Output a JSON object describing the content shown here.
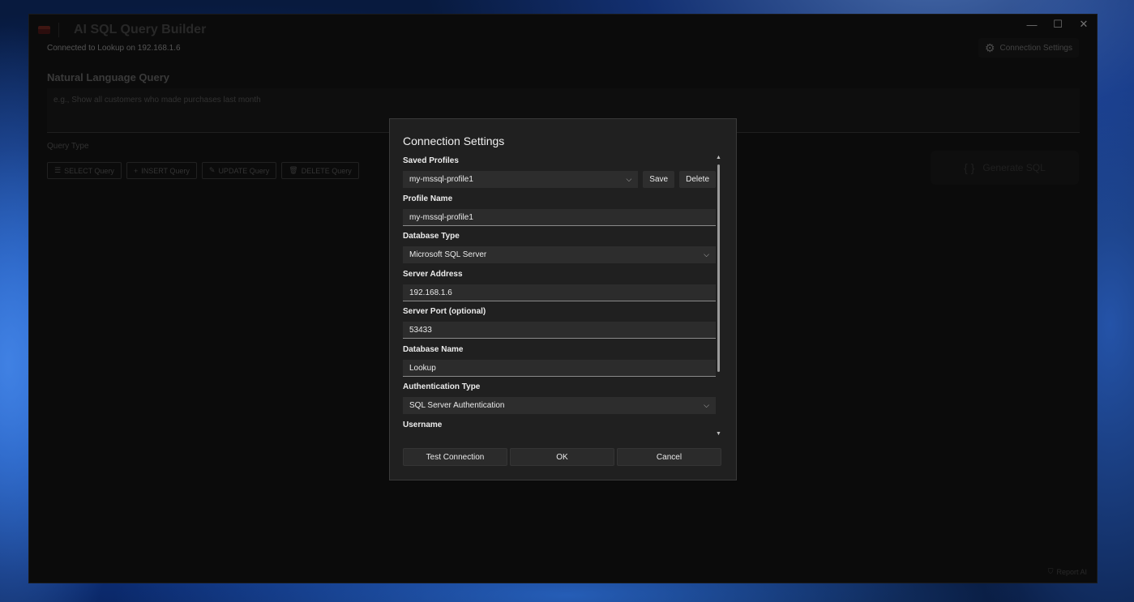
{
  "app": {
    "title": "AI SQL Query Builder",
    "connection_status": "Connected to Lookup on 192.168.1.6",
    "connection_settings_label": "Connection Settings",
    "window_controls": {
      "minimize": "—",
      "maximize": "☐",
      "close": "✕"
    },
    "nl_section_label": "Natural Language Query",
    "nl_placeholder": "e.g., Show all customers who made purchases last month",
    "query_type_label": "Query Type",
    "query_types": [
      {
        "label": "SELECT Query",
        "icon": "☰"
      },
      {
        "label": "INSERT Query",
        "icon": "+"
      },
      {
        "label": "UPDATE Query",
        "icon": "✎"
      },
      {
        "label": "DELETE Query",
        "icon": "🗑"
      }
    ],
    "generate_label": "Generate SQL",
    "generate_icon": "{ }",
    "report_label": "Report AI"
  },
  "dialog": {
    "title": "Connection Settings",
    "saved_profiles_label": "Saved Profiles",
    "saved_profile_value": "my-mssql-profile1",
    "save_label": "Save",
    "delete_label": "Delete",
    "profile_name_label": "Profile Name",
    "profile_name_value": "my-mssql-profile1",
    "database_type_label": "Database Type",
    "database_type_value": "Microsoft SQL Server",
    "server_address_label": "Server Address",
    "server_address_value": "192.168.1.6",
    "server_port_label": "Server Port (optional)",
    "server_port_value": "53433",
    "database_name_label": "Database Name",
    "database_name_value": "Lookup",
    "auth_type_label": "Authentication Type",
    "auth_type_value": "SQL Server Authentication",
    "username_label": "Username",
    "buttons": {
      "test": "Test Connection",
      "ok": "OK",
      "cancel": "Cancel"
    }
  }
}
